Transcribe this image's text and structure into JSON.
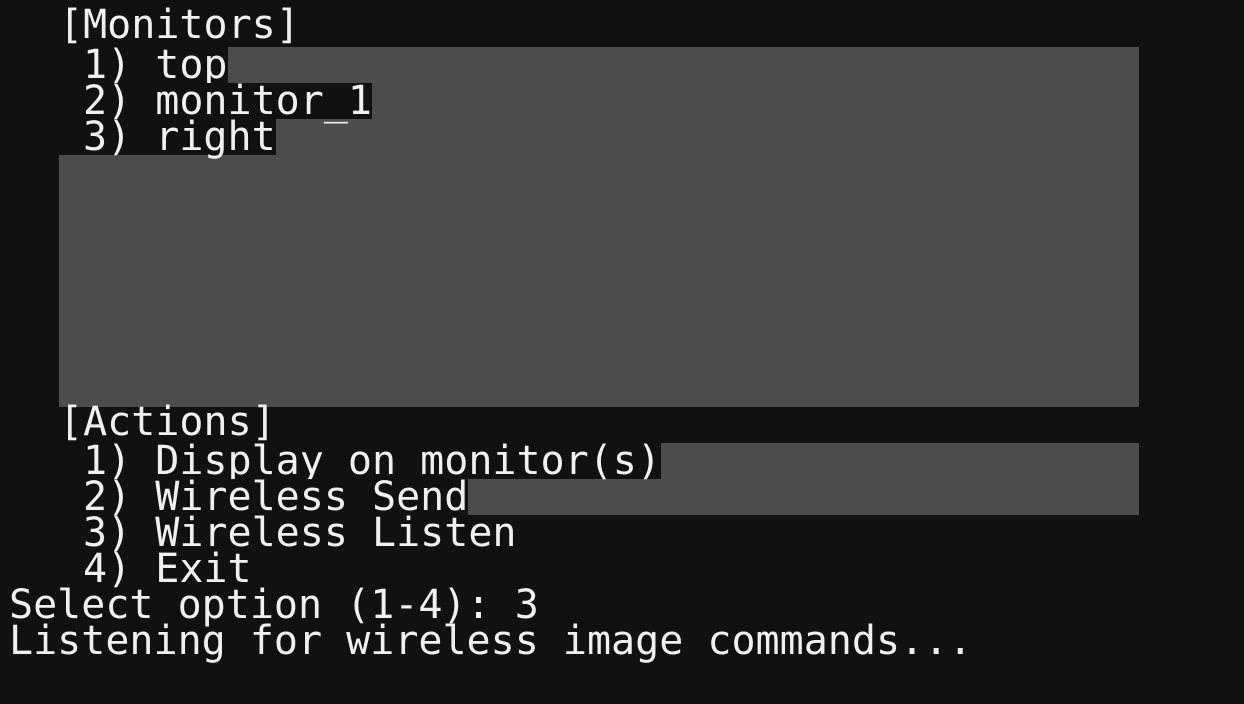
{
  "monitors": {
    "header": "[Monitors]",
    "items": [
      {
        "label": "1) top"
      },
      {
        "label": "2) monitor_1"
      },
      {
        "label": "3) right"
      }
    ]
  },
  "actions": {
    "header": "[Actions]",
    "items": [
      {
        "label": "1) Display on monitor(s)"
      },
      {
        "label": "2) Wireless Send"
      },
      {
        "label": "3) Wireless Listen"
      },
      {
        "label": "4) Exit"
      }
    ]
  },
  "prompt": {
    "text": "Select option (1-4): 3"
  },
  "status": {
    "text": "Listening for wireless image commands..."
  },
  "colors": {
    "background": "#111111",
    "panel": "#4c4c4c",
    "text": "#f0f0f0"
  }
}
